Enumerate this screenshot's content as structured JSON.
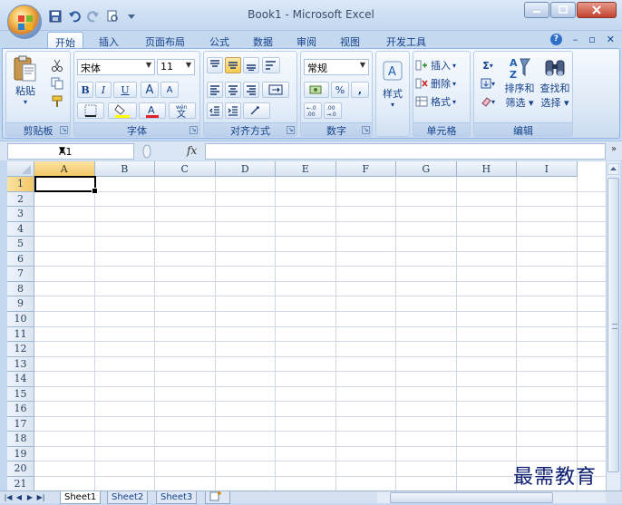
{
  "window": {
    "title": "Book1 - Microsoft Excel"
  },
  "tabs": [
    {
      "label": "开始",
      "active": true
    },
    {
      "label": "插入"
    },
    {
      "label": "页面布局"
    },
    {
      "label": "公式"
    },
    {
      "label": "数据"
    },
    {
      "label": "审阅"
    },
    {
      "label": "视图"
    },
    {
      "label": "开发工具"
    }
  ],
  "ribbon": {
    "clipboard": {
      "label": "剪贴板",
      "paste": "粘贴"
    },
    "font": {
      "label": "字体",
      "name": "宋体",
      "size": "11",
      "bold": "B",
      "italic": "I",
      "underline": "U",
      "grow": "A",
      "shrink": "A"
    },
    "alignment": {
      "label": "对齐方式"
    },
    "number": {
      "label": "数字",
      "format": "常规",
      "percent": "%",
      "comma": ","
    },
    "styles": {
      "label": "样式"
    },
    "cells": {
      "label": "单元格",
      "insert": "插入",
      "delete": "删除",
      "format": "格式"
    },
    "editing": {
      "label": "编辑",
      "sum": "Σ",
      "sort": "排序和",
      "sort2": "筛选",
      "find": "查找和",
      "find2": "选择"
    }
  },
  "formula_bar": {
    "name_box": "A1",
    "fx": "fx",
    "value": ""
  },
  "grid": {
    "columns": [
      "A",
      "B",
      "C",
      "D",
      "E",
      "F",
      "G",
      "H",
      "I"
    ],
    "rows": [
      "1",
      "2",
      "3",
      "4",
      "5",
      "6",
      "7",
      "8",
      "9",
      "10",
      "11",
      "12",
      "13",
      "14",
      "15",
      "16",
      "17",
      "18",
      "19",
      "20",
      "21"
    ],
    "active_cell": "A1"
  },
  "sheets": [
    {
      "label": "Sheet1",
      "active": true
    },
    {
      "label": "Sheet2"
    },
    {
      "label": "Sheet3"
    }
  ],
  "watermark": "最需教育"
}
